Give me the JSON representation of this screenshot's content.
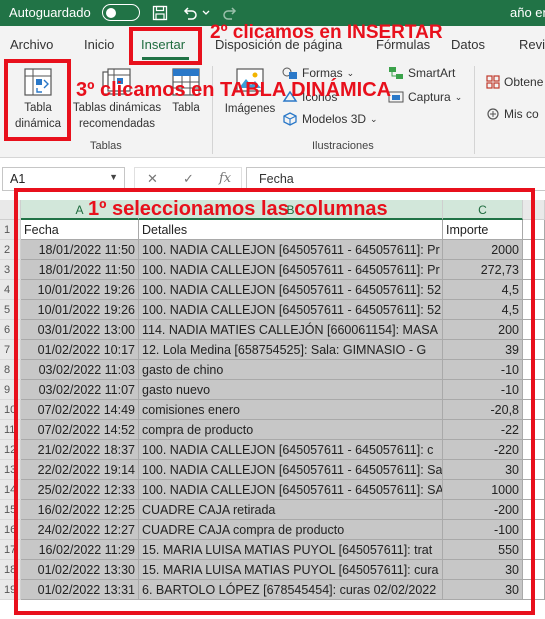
{
  "titlebar": {
    "autosave_label": "Autoguardado",
    "doc_title": "año en",
    "icons": [
      "save-icon",
      "undo-icon",
      "redo-icon"
    ]
  },
  "tabs": [
    {
      "label": "Archivo"
    },
    {
      "label": "Inicio"
    },
    {
      "label": "Insertar",
      "active": true
    },
    {
      "label": "Disposición de página"
    },
    {
      "label": "Fórmulas"
    },
    {
      "label": "Datos"
    },
    {
      "label": "Revi"
    }
  ],
  "ribbon": {
    "tabla_dinamica": "Tabla\ndinámica",
    "tablas_recomendadas": "Tablas dinámicas\nrecomendadas",
    "tabla": "Tabla",
    "imagenes": "Imágenes",
    "formas": "Formas",
    "iconos": "Iconos",
    "modelos3d": "Modelos 3D",
    "smartart": "SmartArt",
    "captura": "Captura",
    "obtener": "Obtene",
    "mis": "Mis co",
    "group_tablas": "Tablas",
    "group_ilustraciones": "Ilustraciones"
  },
  "formula_bar": {
    "cell_ref": "A1",
    "fx_icon": "fx",
    "value": "Fecha"
  },
  "grid": {
    "col_headers": [
      "A",
      "B",
      "C"
    ],
    "header_row": {
      "fecha": "Fecha",
      "detalles": "Detalles",
      "importe": "Importe"
    },
    "rows": [
      {
        "fecha": "18/01/2022 11:50",
        "detalles": "100. NADIA CALLEJON [645057611 - 645057611]: Pr",
        "importe": "2000"
      },
      {
        "fecha": "18/01/2022 11:50",
        "detalles": "100. NADIA CALLEJON [645057611 - 645057611]: Pr",
        "importe": "272,73"
      },
      {
        "fecha": "10/01/2022 19:26",
        "detalles": "100. NADIA CALLEJON [645057611 - 645057611]: 52",
        "importe": "4,5"
      },
      {
        "fecha": "10/01/2022 19:26",
        "detalles": "100. NADIA CALLEJON [645057611 - 645057611]: 52",
        "importe": "4,5"
      },
      {
        "fecha": "03/01/2022 13:00",
        "detalles": "114. NADIA MATIES CALLEJÓN [660061154]: MASA",
        "importe": "200"
      },
      {
        "fecha": "01/02/2022 10:17",
        "detalles": "12. Lola Medina  [658754525]: Sala: GIMNASIO - G",
        "importe": "39"
      },
      {
        "fecha": "03/02/2022 11:03",
        "detalles": "gasto de chino",
        "importe": "-10"
      },
      {
        "fecha": "03/02/2022 11:07",
        "detalles": "gasto nuevo",
        "importe": "-10"
      },
      {
        "fecha": "07/02/2022 14:49",
        "detalles": "comisiones enero",
        "importe": "-20,8"
      },
      {
        "fecha": "07/02/2022 14:52",
        "detalles": "compra de producto",
        "importe": "-22"
      },
      {
        "fecha": "21/02/2022 18:37",
        "detalles": "100. NADIA CALLEJON [645057611 - 645057611]: c",
        "importe": "-220"
      },
      {
        "fecha": "22/02/2022 19:14",
        "detalles": "100. NADIA CALLEJON [645057611 - 645057611]: Sa",
        "importe": "30"
      },
      {
        "fecha": "25/02/2022 12:33",
        "detalles": "100. NADIA CALLEJON [645057611 - 645057611]: SA",
        "importe": "1000"
      },
      {
        "fecha": "16/02/2022 12:25",
        "detalles": "CUADRE CAJA retirada",
        "importe": "-200"
      },
      {
        "fecha": "24/02/2022 12:27",
        "detalles": "CUADRE CAJA compra de producto",
        "importe": "-100"
      },
      {
        "fecha": "16/02/2022 11:29",
        "detalles": "15. MARIA LUISA MATIAS PUYOL [645057611]: trat",
        "importe": "550"
      },
      {
        "fecha": "01/02/2022 13:30",
        "detalles": "15. MARIA LUISA MATIAS PUYOL [645057611]: cura",
        "importe": "30"
      },
      {
        "fecha": "01/02/2022 13:31",
        "detalles": "6. BARTOLO LÓPEZ [678545454]: curas  02/02/2022",
        "importe": "30"
      }
    ]
  },
  "annotations": {
    "step1": "1º seleccionamos las columnas",
    "step2": "2º clicamos en INSERTAR",
    "step3": "3º clicamos en TABLA DINÁMICA",
    "color": "#e8101c"
  },
  "colors": {
    "excel_green": "#217346",
    "selection_gray": "#c7c7c7",
    "ribbon_bg": "#f3f3f3"
  }
}
